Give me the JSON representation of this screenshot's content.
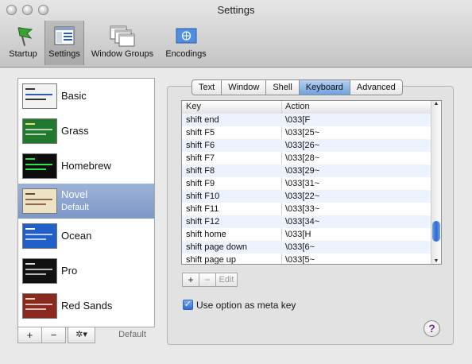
{
  "window": {
    "title": "Settings"
  },
  "toolbar": {
    "items": [
      {
        "label": "Startup",
        "icon": "startup-flag-icon"
      },
      {
        "label": "Settings",
        "icon": "settings-window-icon",
        "selected": true
      },
      {
        "label": "Window Groups",
        "icon": "window-groups-icon"
      },
      {
        "label": "Encodings",
        "icon": "encodings-flag-icon"
      }
    ]
  },
  "profiles": {
    "items": [
      {
        "name": "Basic",
        "subtitle": "",
        "bg": "#f2f2f2",
        "fg": "#333333"
      },
      {
        "name": "Grass",
        "subtitle": "",
        "bg": "#1f7a2e",
        "fg": "#e8e070"
      },
      {
        "name": "Homebrew",
        "subtitle": "",
        "bg": "#0d0d0d",
        "fg": "#2ee04a"
      },
      {
        "name": "Novel",
        "subtitle": "Default",
        "bg": "#ede3c4",
        "fg": "#6a4a2a",
        "selected": true
      },
      {
        "name": "Ocean",
        "subtitle": "",
        "bg": "#2160c9",
        "fg": "#ffffff"
      },
      {
        "name": "Pro",
        "subtitle": "",
        "bg": "#111111",
        "fg": "#dddddd"
      },
      {
        "name": "Red Sands",
        "subtitle": "",
        "bg": "#8a2a1e",
        "fg": "#e6d6b0"
      }
    ],
    "add_label": "+",
    "remove_label": "−",
    "action_label": "✲▾",
    "default_label": "Default"
  },
  "tabs": [
    {
      "label": "Text"
    },
    {
      "label": "Window"
    },
    {
      "label": "Shell"
    },
    {
      "label": "Keyboard",
      "selected": true
    },
    {
      "label": "Advanced"
    }
  ],
  "keyboard_table": {
    "headers": {
      "key": "Key",
      "action": "Action"
    },
    "rows": [
      {
        "key": "shift end",
        "action": "\\033[F"
      },
      {
        "key": "shift F5",
        "action": "\\033[25~"
      },
      {
        "key": "shift F6",
        "action": "\\033[26~"
      },
      {
        "key": "shift F7",
        "action": "\\033[28~"
      },
      {
        "key": "shift F8",
        "action": "\\033[29~"
      },
      {
        "key": "shift F9",
        "action": "\\033[31~"
      },
      {
        "key": "shift F10",
        "action": "\\033[22~"
      },
      {
        "key": "shift F11",
        "action": "\\033[33~"
      },
      {
        "key": "shift F12",
        "action": "\\033[34~"
      },
      {
        "key": "shift home",
        "action": "\\033[H"
      },
      {
        "key": "shift page down",
        "action": "\\033[6~"
      },
      {
        "key": "shift page up",
        "action": "\\033[5~"
      }
    ],
    "scroll_position": 0.88
  },
  "table_buttons": {
    "add": "+",
    "remove": "−",
    "edit": "Edit"
  },
  "option_meta": {
    "label": "Use option as meta key",
    "checked": true
  },
  "help": {
    "label": "?"
  }
}
